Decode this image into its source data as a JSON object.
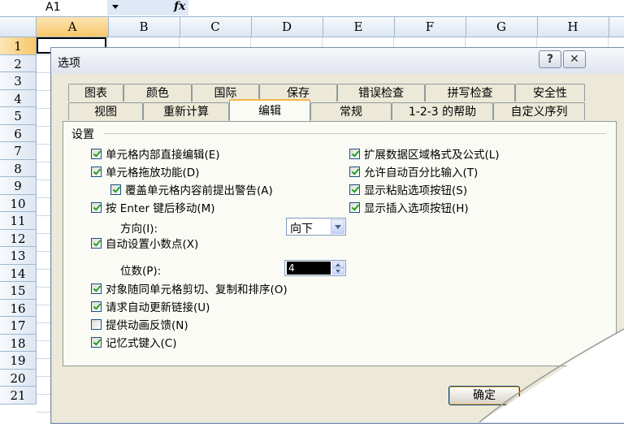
{
  "sheet": {
    "name_box": "A1",
    "fx": "fx",
    "columns": [
      "A",
      "B",
      "C",
      "D",
      "E",
      "F",
      "G",
      "H"
    ],
    "rows": [
      "1",
      "2",
      "3",
      "4",
      "5",
      "6",
      "7",
      "8",
      "9",
      "10",
      "11",
      "12",
      "13",
      "14",
      "15",
      "16",
      "17",
      "18",
      "19",
      "20",
      "21"
    ],
    "selected_column": "A",
    "selected_row": "1"
  },
  "dialog": {
    "title": "选项",
    "help_label": "?",
    "tabs_row1": [
      "图表",
      "颜色",
      "国际",
      "保存",
      "错误检查",
      "拼写检查",
      "安全性"
    ],
    "tabs_row2": [
      "视图",
      "重新计算",
      "编辑",
      "常规",
      "1-2-3 的帮助",
      "自定义序列"
    ],
    "active_tab": "编辑",
    "group_label": "设置",
    "left_options": [
      {
        "label": "单元格内部直接编辑(E)",
        "checked": true
      },
      {
        "label": "单元格拖放功能(D)",
        "checked": true
      },
      {
        "label": "覆盖单元格内容前提出警告(A)",
        "checked": true
      },
      {
        "label": "按 Enter 键后移动(M)",
        "checked": true
      },
      {
        "label": "自动设置小数点(X)",
        "checked": true
      },
      {
        "label": "对象随同单元格剪切、复制和排序(O)",
        "checked": true
      },
      {
        "label": "请求自动更新链接(U)",
        "checked": true
      },
      {
        "label": "提供动画反馈(N)",
        "checked": false
      },
      {
        "label": "记忆式键入(C)",
        "checked": true
      }
    ],
    "right_options": [
      {
        "label": "扩展数据区域格式及公式(L)",
        "checked": true
      },
      {
        "label": "允许自动百分比输入(T)",
        "checked": true
      },
      {
        "label": "显示粘贴选项按钮(S)",
        "checked": true
      },
      {
        "label": "显示插入选项按钮(H)",
        "checked": true
      }
    ],
    "direction_label": "方向(I):",
    "direction_value": "向下",
    "places_label": "位数(P):",
    "places_value": "4",
    "ok_label": "确定"
  }
}
